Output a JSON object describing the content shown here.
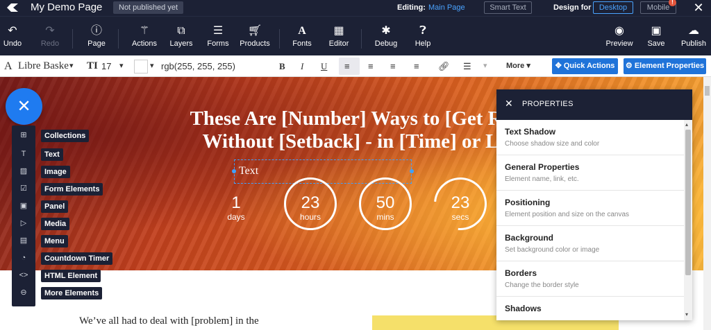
{
  "topbar": {
    "title": "My Demo Page",
    "status": "Not published yet",
    "editing_label": "Editing:",
    "editing_value": "Main Page",
    "smart_text": "Smart Text",
    "design_for": "Design for",
    "desktop": "Desktop",
    "mobile": "Mobile",
    "mobile_badge": "!"
  },
  "toolbar": [
    {
      "label": "Undo",
      "icon": "undo-icon"
    },
    {
      "label": "Redo",
      "icon": "redo-icon"
    },
    {
      "label": "Page",
      "icon": "info-icon"
    },
    {
      "label": "Actions",
      "icon": "magic-wand-icon"
    },
    {
      "label": "Layers",
      "icon": "layers-icon"
    },
    {
      "label": "Forms",
      "icon": "list-icon"
    },
    {
      "label": "Products",
      "icon": "cart-icon"
    },
    {
      "label": "Fonts",
      "icon": "font-icon"
    },
    {
      "label": "Editor",
      "icon": "grid-icon"
    },
    {
      "label": "Debug",
      "icon": "bug-icon"
    },
    {
      "label": "Help",
      "icon": "question-icon"
    },
    {
      "label": "Preview",
      "icon": "eye-icon"
    },
    {
      "label": "Save",
      "icon": "save-icon"
    },
    {
      "label": "Publish",
      "icon": "cloud-upload-icon"
    }
  ],
  "format": {
    "font": "Libre Baske",
    "size": "17",
    "color": "rgb(255, 255, 255)",
    "more": "More",
    "quick_actions": "Quick Actions",
    "element_properties": "Element Properties"
  },
  "hero": {
    "title_line1": "These Are [Number] Ways to [Get Re",
    "title_line2": "Without [Setback] - in [Time] or L",
    "text_box": "Text"
  },
  "countdown": [
    {
      "value": "1",
      "label": "days"
    },
    {
      "value": "23",
      "label": "hours"
    },
    {
      "value": "50",
      "label": "mins"
    },
    {
      "value": "23",
      "label": "secs"
    }
  ],
  "body_text": "We’ve all had to deal with [problem] in the",
  "sidebar": [
    {
      "label": "Collections",
      "icon": "collections-icon"
    },
    {
      "label": "Text",
      "icon": "text-icon"
    },
    {
      "label": "Image",
      "icon": "image-icon"
    },
    {
      "label": "Form Elements",
      "icon": "form-icon"
    },
    {
      "label": "Panel",
      "icon": "panel-icon"
    },
    {
      "label": "Media",
      "icon": "media-icon"
    },
    {
      "label": "Menu",
      "icon": "menu-icon"
    },
    {
      "label": "Countdown Timer",
      "icon": "timer-icon"
    },
    {
      "label": "HTML Element",
      "icon": "code-icon"
    },
    {
      "label": "More Elements",
      "icon": "more-icon"
    }
  ],
  "properties": {
    "title": "PROPERTIES",
    "items": [
      {
        "title": "Text Shadow",
        "desc": "Choose shadow size and color"
      },
      {
        "title": "General Properties",
        "desc": "Element name, link, etc."
      },
      {
        "title": "Positioning",
        "desc": "Element position and size on the canvas"
      },
      {
        "title": "Background",
        "desc": "Set background color or image"
      },
      {
        "title": "Borders",
        "desc": "Change the border style"
      },
      {
        "title": "Shadows",
        "desc": ""
      }
    ]
  },
  "colors": {
    "topbar": "#1c2135",
    "accent": "#1f73d9",
    "link": "#4aa3ff"
  }
}
